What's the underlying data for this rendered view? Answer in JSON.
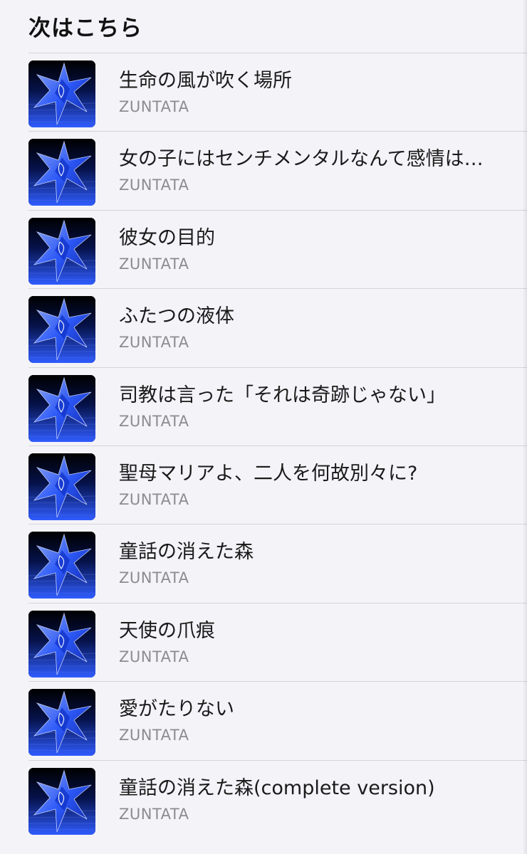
{
  "header": {
    "title": "次はこちら"
  },
  "artwork": {
    "icon": "blue-star-album-art",
    "accent": "#2f5cff",
    "background": "#000000"
  },
  "tracks": [
    {
      "title": "生命の風が吹く場所",
      "artist": "ZUNTATA"
    },
    {
      "title": "女の子にはセンチメンタルなんて感情は…",
      "artist": "ZUNTATA"
    },
    {
      "title": "彼女の目的",
      "artist": "ZUNTATA"
    },
    {
      "title": "ふたつの液体",
      "artist": "ZUNTATA"
    },
    {
      "title": "司教は言った「それは奇跡じゃない」",
      "artist": "ZUNTATA"
    },
    {
      "title": "聖母マリアよ、二人を何故別々に?",
      "artist": "ZUNTATA"
    },
    {
      "title": "童話の消えた森",
      "artist": "ZUNTATA"
    },
    {
      "title": "天使の爪痕",
      "artist": "ZUNTATA"
    },
    {
      "title": "愛がたりない",
      "artist": "ZUNTATA"
    },
    {
      "title": "童話の消えた森(complete version)",
      "artist": "ZUNTATA"
    }
  ]
}
